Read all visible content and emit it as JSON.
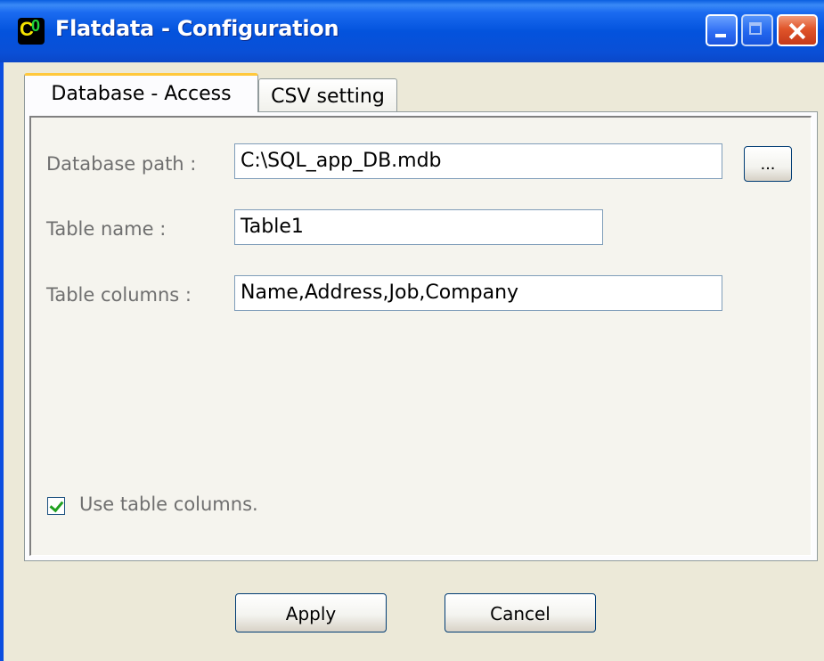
{
  "window": {
    "title": "Flatdata - Configuration",
    "icon": "app-logo-icon",
    "icon_text_1": "C",
    "icon_text_2": "0",
    "controls": [
      "minimize-icon",
      "maximize-icon",
      "close-icon"
    ]
  },
  "tabs": [
    {
      "label": "Database - Access",
      "active": true
    },
    {
      "label": "CSV setting",
      "active": false
    }
  ],
  "form": {
    "database_path": {
      "label": "Database path :",
      "value": "C:\\SQL_app_DB.mdb"
    },
    "browse_button": {
      "label": "..."
    },
    "table_name": {
      "label": "Table name :",
      "value": "Table1"
    },
    "table_columns": {
      "label": "Table columns :",
      "value": "Name,Address,Job,Company"
    },
    "use_table_columns": {
      "label": "Use table columns.",
      "checked": true
    }
  },
  "buttons": {
    "apply": "Apply",
    "cancel": "Cancel"
  },
  "colors": {
    "titlebar": "#0353dd",
    "dialog_bg": "#ece9d8",
    "tab_highlight": "#ffc83c",
    "checkmark": "#21a121"
  }
}
